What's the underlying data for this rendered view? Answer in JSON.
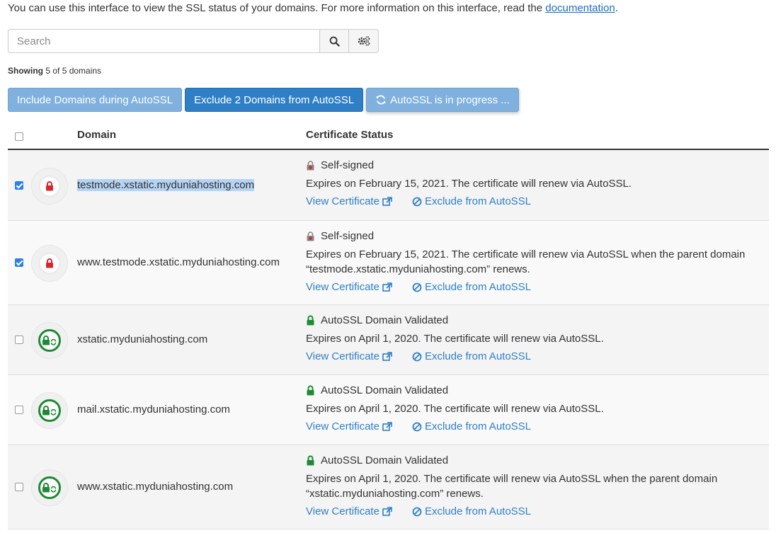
{
  "intro": {
    "text": "You can use this interface to view the SSL status of your domains. For more information on this interface, read the",
    "link": "documentation",
    "end": "."
  },
  "search": {
    "placeholder": "Search",
    "value": ""
  },
  "toolbar": {
    "search_icon": "search-icon",
    "settings_icon": "gears-icon"
  },
  "showing": {
    "label": "Showing",
    "text": "5 of 5 domains"
  },
  "actions": {
    "include": "Include Domains during AutoSSL",
    "exclude": "Exclude 2 Domains from AutoSSL",
    "progress": "AutoSSL is in progress ..."
  },
  "table": {
    "headers": {
      "domain": "Domain",
      "status": "Certificate Status"
    },
    "view_link": "View Certificate",
    "exclude_link": "Exclude from AutoSSL",
    "rows": [
      {
        "checked": true,
        "selected": true,
        "state": "self-signed",
        "domain": "testmode.xstatic.myduniahosting.com",
        "status": "Self-signed",
        "expires": [
          "Expires on February 15, 2021. The certificate will renew via AutoSSL."
        ]
      },
      {
        "checked": true,
        "selected": false,
        "state": "self-signed",
        "domain": "www.testmode.xstatic.myduniahosting.com",
        "status": "Self-signed",
        "expires": [
          "Expires on February 15, 2021. The certificate will renew via AutoSSL when the parent domain",
          "“testmode.xstatic.myduniahosting.com” renews."
        ]
      },
      {
        "checked": false,
        "selected": false,
        "state": "validated",
        "domain": "xstatic.myduniahosting.com",
        "status": "AutoSSL Domain Validated",
        "expires": [
          "Expires on April 1, 2020. The certificate will renew via AutoSSL."
        ]
      },
      {
        "checked": false,
        "selected": false,
        "state": "validated",
        "domain": "mail.xstatic.myduniahosting.com",
        "status": "AutoSSL Domain Validated",
        "expires": [
          "Expires on April 1, 2020. The certificate will renew via AutoSSL."
        ]
      },
      {
        "checked": false,
        "selected": false,
        "state": "validated",
        "domain": "www.xstatic.myduniahosting.com",
        "status": "AutoSSL Domain Validated",
        "expires": [
          "Expires on April 1, 2020. The certificate will renew via AutoSSL when the parent domain",
          "“xstatic.myduniahosting.com” renews."
        ]
      }
    ]
  },
  "colors": {
    "link": "#2f7fc7",
    "primary": "#2f7fc7",
    "light": "#7fb0de",
    "danger": "#d9262c",
    "success": "#1e8a34"
  }
}
